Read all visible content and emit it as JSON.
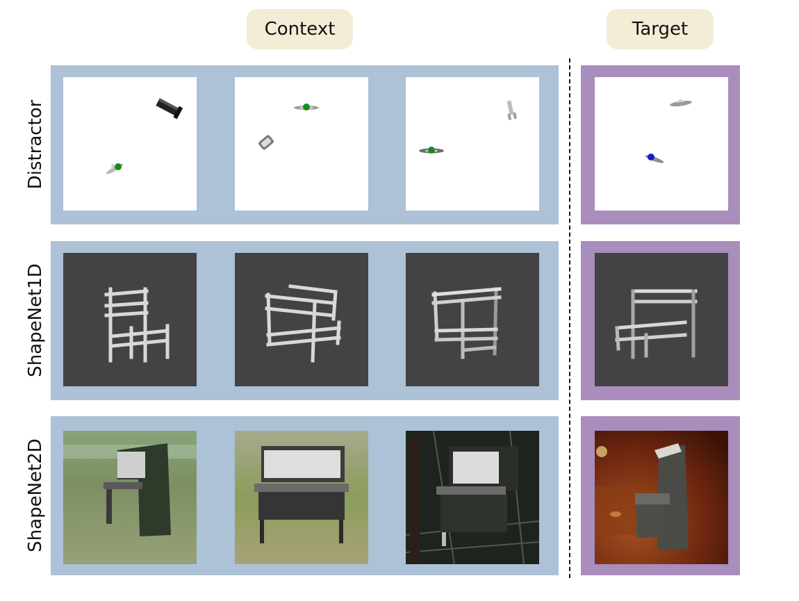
{
  "headers": {
    "context": "Context",
    "target": "Target"
  },
  "rows": [
    {
      "label": "Distractor",
      "tile_style": "white background, scattered objects, green/blue dot markers"
    },
    {
      "label": "ShapeNet1D",
      "tile_style": "dark gray background, bunk bed renders"
    },
    {
      "label": "ShapeNet2D",
      "tile_style": "natural photo backgrounds, upright piano renders"
    }
  ],
  "colors": {
    "context_panel": "#adc1d7",
    "target_panel": "#a98dbd",
    "header_pill": "#f3ecd6",
    "marker_context": "#1a8a1a",
    "marker_target": "#1a1ad0"
  }
}
